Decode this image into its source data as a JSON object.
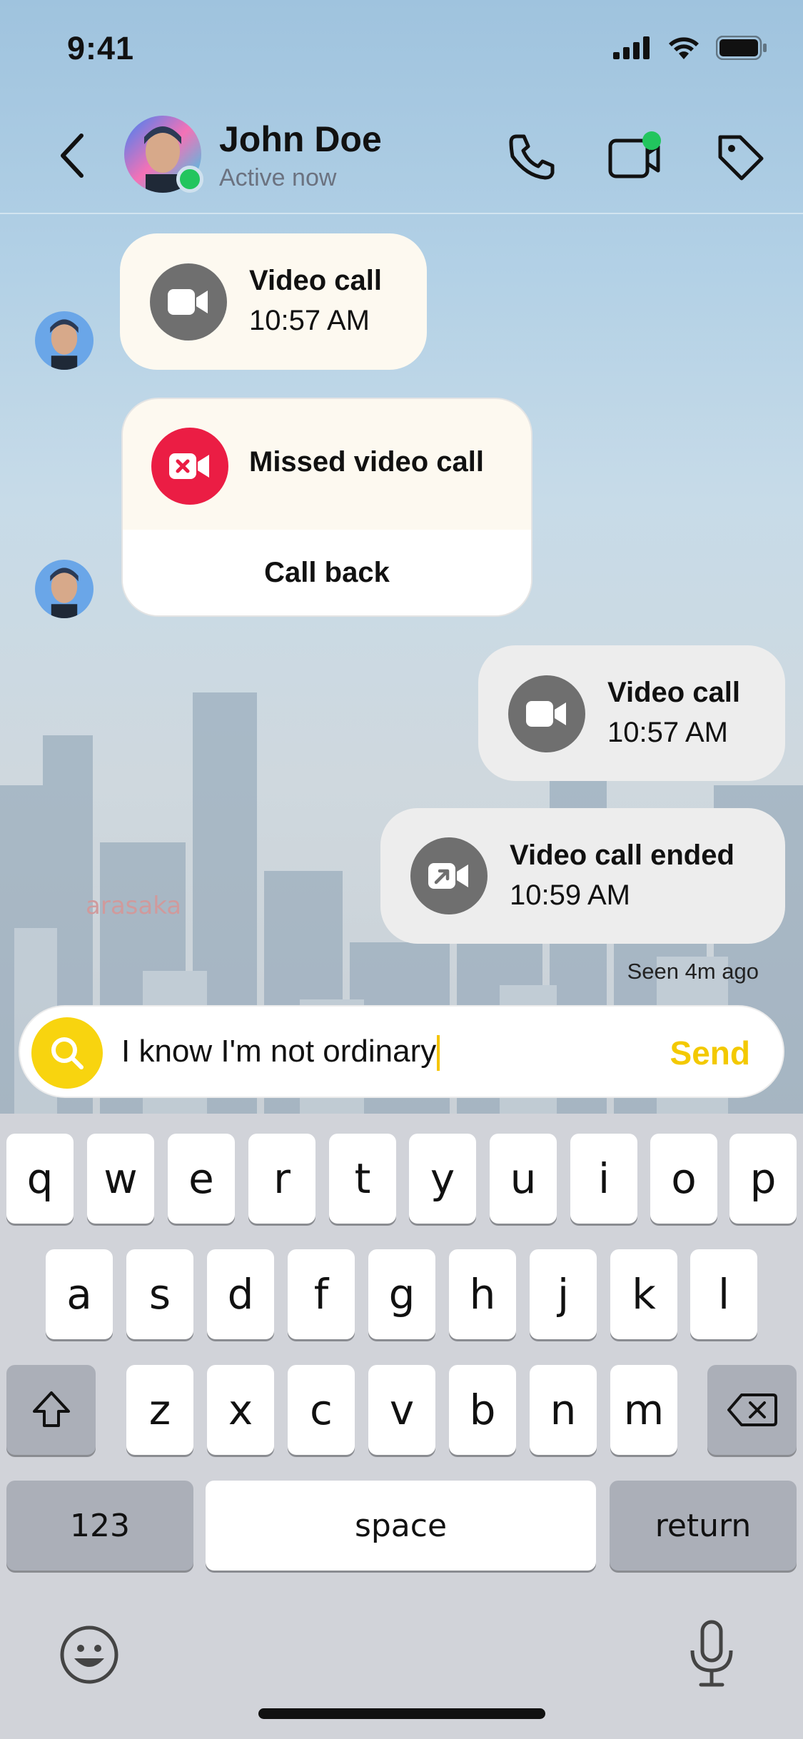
{
  "status_bar": {
    "time": "9:41"
  },
  "header": {
    "contact_name": "John Doe",
    "contact_status": "Active now"
  },
  "messages": [
    {
      "direction": "incoming",
      "type": "video_call",
      "title": "Video call",
      "time": "10:57 AM"
    },
    {
      "direction": "incoming",
      "type": "missed_video_call",
      "title": "Missed video call",
      "action": "Call back"
    },
    {
      "direction": "outgoing",
      "type": "video_call",
      "title": "Video call",
      "time": "10:57 AM"
    },
    {
      "direction": "outgoing",
      "type": "video_call_ended",
      "title": "Video call ended",
      "time": "10:59 AM"
    }
  ],
  "seen_text": "Seen 4m ago",
  "composer": {
    "value": "I know I'm not ordinary",
    "send_label": "Send"
  },
  "keyboard": {
    "row1": [
      "q",
      "w",
      "e",
      "r",
      "t",
      "y",
      "u",
      "i",
      "o",
      "p"
    ],
    "row2": [
      "a",
      "s",
      "d",
      "f",
      "g",
      "h",
      "j",
      "k",
      "l"
    ],
    "row3": [
      "z",
      "x",
      "c",
      "v",
      "b",
      "n",
      "m"
    ],
    "numbers_label": "123",
    "space_label": "space",
    "return_label": "return"
  },
  "colors": {
    "accent_yellow": "#f8d40f",
    "online_green": "#22c55e",
    "missed_red": "#eb1d44",
    "icon_gray": "#6f6f6f"
  }
}
